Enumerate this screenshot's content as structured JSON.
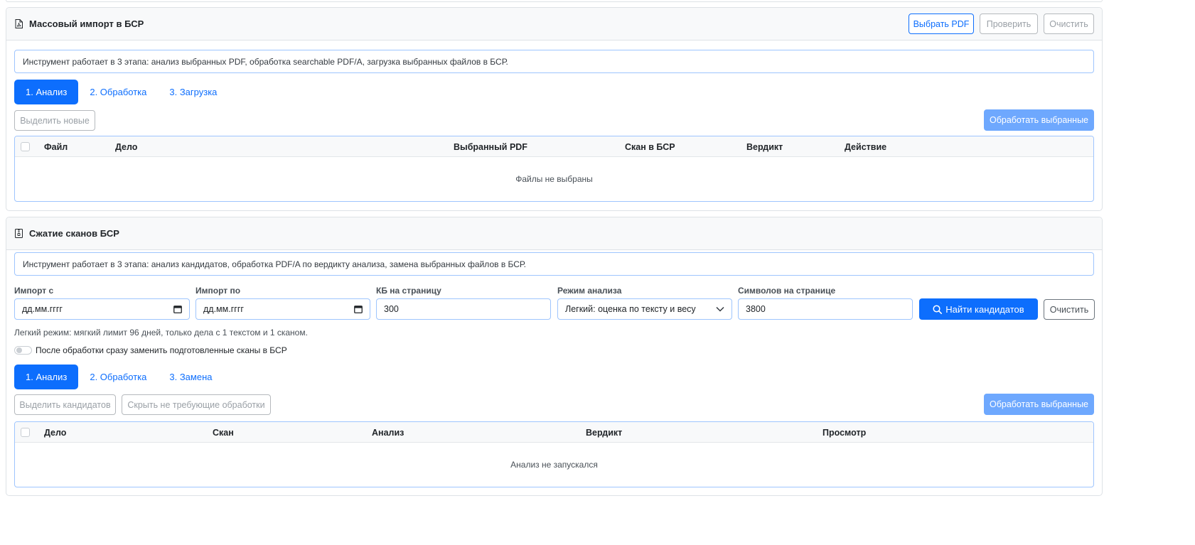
{
  "import_card": {
    "title": "Массовый импорт в БСР",
    "header_icon": "pdf-file-icon",
    "buttons": {
      "choose_pdf": "Выбрать PDF",
      "check": "Проверить",
      "clear": "Очистить"
    },
    "info": "Инструмент работает в 3 этапа: анализ выбранных PDF, обработка searchable PDF/A, загрузка выбранных файлов в БСР.",
    "tabs": [
      "1. Анализ",
      "2. Обработка",
      "3. Загрузка"
    ],
    "active_tab": "1. Анализ",
    "select_new_button": "Выделить новые",
    "process_selected_button": "Обработать выбранные",
    "table": {
      "columns": [
        "Файл",
        "Дело",
        "Выбранный PDF",
        "Скан в БСР",
        "Вердикт",
        "Действие"
      ],
      "empty_text": "Файлы не выбраны"
    }
  },
  "compress_card": {
    "title": "Сжатие сканов БСР",
    "header_icon": "archive-file-icon",
    "info": "Инструмент работает в 3 этапа: анализ кандидатов, обработка PDF/A по вердикту анализа, замена выбранных файлов в БСР.",
    "filters": {
      "import_from": {
        "label": "Импорт с",
        "value": "дд.мм.гггг"
      },
      "import_to": {
        "label": "Импорт по",
        "value": "дд.мм.гггг"
      },
      "kb_per_page": {
        "label": "КБ на страницу",
        "value": "300"
      },
      "analysis_mode": {
        "label": "Режим анализа",
        "value": "Легкий: оценка по тексту и весу"
      },
      "chars_per_page": {
        "label": "Символов на странице",
        "value": "3800"
      }
    },
    "find_button": "Найти кандидатов",
    "clear_button": "Очистить",
    "mode_hint": "Легкий режим: мягкий лимит 96 дней, только дела с 1 текстом и 1 сканом.",
    "auto_replace_label": "После обработки сразу заменить подготовленные сканы в БСР",
    "auto_replace_on": false,
    "tabs": [
      "1. Анализ",
      "2. Обработка",
      "3. Замена"
    ],
    "active_tab": "1. Анализ",
    "select_candidates_button": "Выделить кандидатов",
    "hide_unneeded_button": "Скрыть не требующие обработки",
    "process_selected_button": "Обработать выбранные",
    "table": {
      "columns": [
        "Дело",
        "Скан",
        "Анализ",
        "Вердикт",
        "Просмотр"
      ],
      "empty_text": "Анализ не запускался"
    }
  },
  "colors": {
    "primary": "#0d6efd",
    "primary_disabled": "#6ea8fe",
    "border_info": "#9ec5fe",
    "header_bg": "#f8f9fa"
  }
}
